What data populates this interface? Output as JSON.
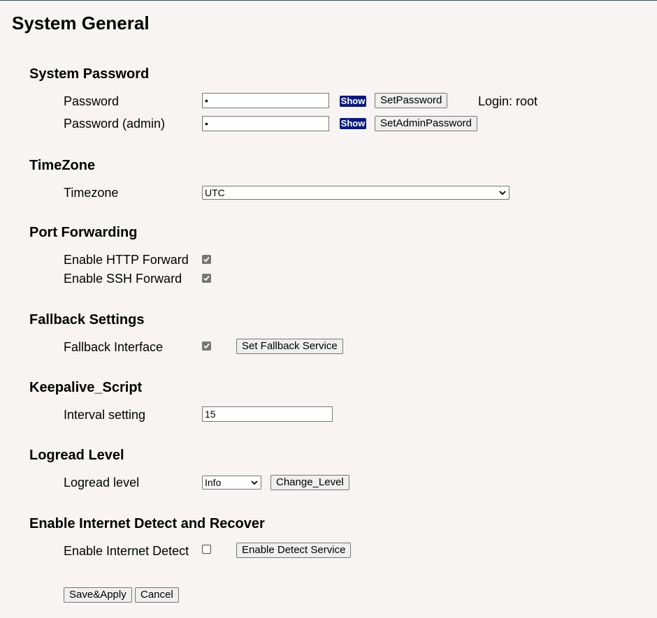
{
  "page": {
    "title": "System General"
  },
  "password": {
    "section_title": "System Password",
    "password_label": "Password",
    "password_value": "•",
    "show_label": "Show",
    "set_password_label": "SetPassword",
    "login_text": "Login: root",
    "admin_label": "Password (admin)",
    "admin_value": "•",
    "set_admin_label": "SetAdminPassword"
  },
  "timezone": {
    "section_title": "TimeZone",
    "label": "Timezone",
    "selected": "UTC"
  },
  "port_forwarding": {
    "section_title": "Port Forwarding",
    "http_label": "Enable HTTP Forward",
    "http_checked": true,
    "ssh_label": "Enable SSH Forward",
    "ssh_checked": true
  },
  "fallback": {
    "section_title": "Fallback Settings",
    "label": "Fallback Interface",
    "checked": true,
    "button_label": "Set Fallback Service"
  },
  "keepalive": {
    "section_title": "Keepalive_Script",
    "label": "Interval setting",
    "value": "15"
  },
  "logread": {
    "section_title": "Logread Level",
    "label": "Logread level",
    "selected": "Info",
    "button_label": "Change_Level"
  },
  "internet_detect": {
    "section_title": "Enable Internet Detect and Recover",
    "label": "Enable Internet Detect",
    "checked": false,
    "button_label": "Enable Detect Service"
  },
  "actions": {
    "save_label": "Save&Apply",
    "cancel_label": "Cancel"
  },
  "icons": {
    "checkmark": "checkmark-icon",
    "dropdown": "chevron-down-icon"
  }
}
